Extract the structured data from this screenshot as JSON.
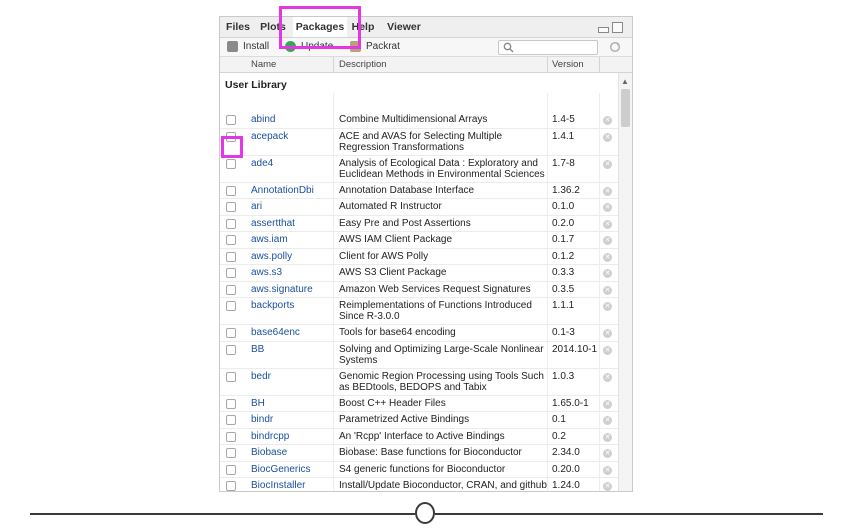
{
  "tabs": [
    {
      "label": "Files",
      "active": false
    },
    {
      "label": "Plots",
      "active": false
    },
    {
      "label": "Packages",
      "active": true
    },
    {
      "label": "Help",
      "active": false
    },
    {
      "label": "Viewer",
      "active": false
    }
  ],
  "toolbar": {
    "install_label": "Install",
    "update_label": "Update",
    "packrat_label": "Packrat",
    "search_placeholder": ""
  },
  "columns": {
    "name": "Name",
    "description": "Description",
    "version": "Version"
  },
  "library_title": "User Library",
  "packages": [
    {
      "name": "abind",
      "description": "Combine Multidimensional Arrays",
      "version": "1.4-5"
    },
    {
      "name": "acepack",
      "description": "ACE and AVAS for Selecting Multiple Regression Transformations",
      "version": "1.4.1"
    },
    {
      "name": "ade4",
      "description": "Analysis of Ecological Data : Exploratory and Euclidean Methods in Environmental Sciences",
      "version": "1.7-8"
    },
    {
      "name": "AnnotationDbi",
      "description": "Annotation Database Interface",
      "version": "1.36.2"
    },
    {
      "name": "ari",
      "description": "Automated R Instructor",
      "version": "0.1.0"
    },
    {
      "name": "assertthat",
      "description": "Easy Pre and Post Assertions",
      "version": "0.2.0"
    },
    {
      "name": "aws.iam",
      "description": "AWS IAM Client Package",
      "version": "0.1.7"
    },
    {
      "name": "aws.polly",
      "description": "Client for AWS Polly",
      "version": "0.1.2"
    },
    {
      "name": "aws.s3",
      "description": "AWS S3 Client Package",
      "version": "0.3.3"
    },
    {
      "name": "aws.signature",
      "description": "Amazon Web Services Request Signatures",
      "version": "0.3.5"
    },
    {
      "name": "backports",
      "description": "Reimplementations of Functions Introduced Since R-3.0.0",
      "version": "1.1.1"
    },
    {
      "name": "base64enc",
      "description": "Tools for base64 encoding",
      "version": "0.1-3"
    },
    {
      "name": "BB",
      "description": "Solving and Optimizing Large-Scale Nonlinear Systems",
      "version": "2014.10-1"
    },
    {
      "name": "bedr",
      "description": "Genomic Region Processing using Tools Such as BEDtools, BEDOPS and Tabix",
      "version": "1.0.3"
    },
    {
      "name": "BH",
      "description": "Boost C++ Header Files",
      "version": "1.65.0-1"
    },
    {
      "name": "bindr",
      "description": "Parametrized Active Bindings",
      "version": "0.1"
    },
    {
      "name": "bindrcpp",
      "description": "An 'Rcpp' Interface to Active Bindings",
      "version": "0.2"
    },
    {
      "name": "Biobase",
      "description": "Biobase: Base functions for Bioconductor",
      "version": "2.34.0"
    },
    {
      "name": "BiocGenerics",
      "description": "S4 generic functions for Bioconductor",
      "version": "0.20.0"
    },
    {
      "name": "BiocInstaller",
      "description": "Install/Update Bioconductor, CRAN, and github Packages",
      "version": "1.24.0"
    }
  ],
  "colors": {
    "highlight": "#e436e4",
    "package_link": "#1b4f9c",
    "install_icon": "#8a8a8a",
    "update_icon": "#3aa655",
    "packrat_icon": "#b9a27a"
  },
  "icons": {
    "install": "install-icon",
    "update": "update-icon",
    "packrat": "packrat-icon",
    "search": "search-icon",
    "refresh": "refresh-icon",
    "remove": "remove-icon"
  }
}
